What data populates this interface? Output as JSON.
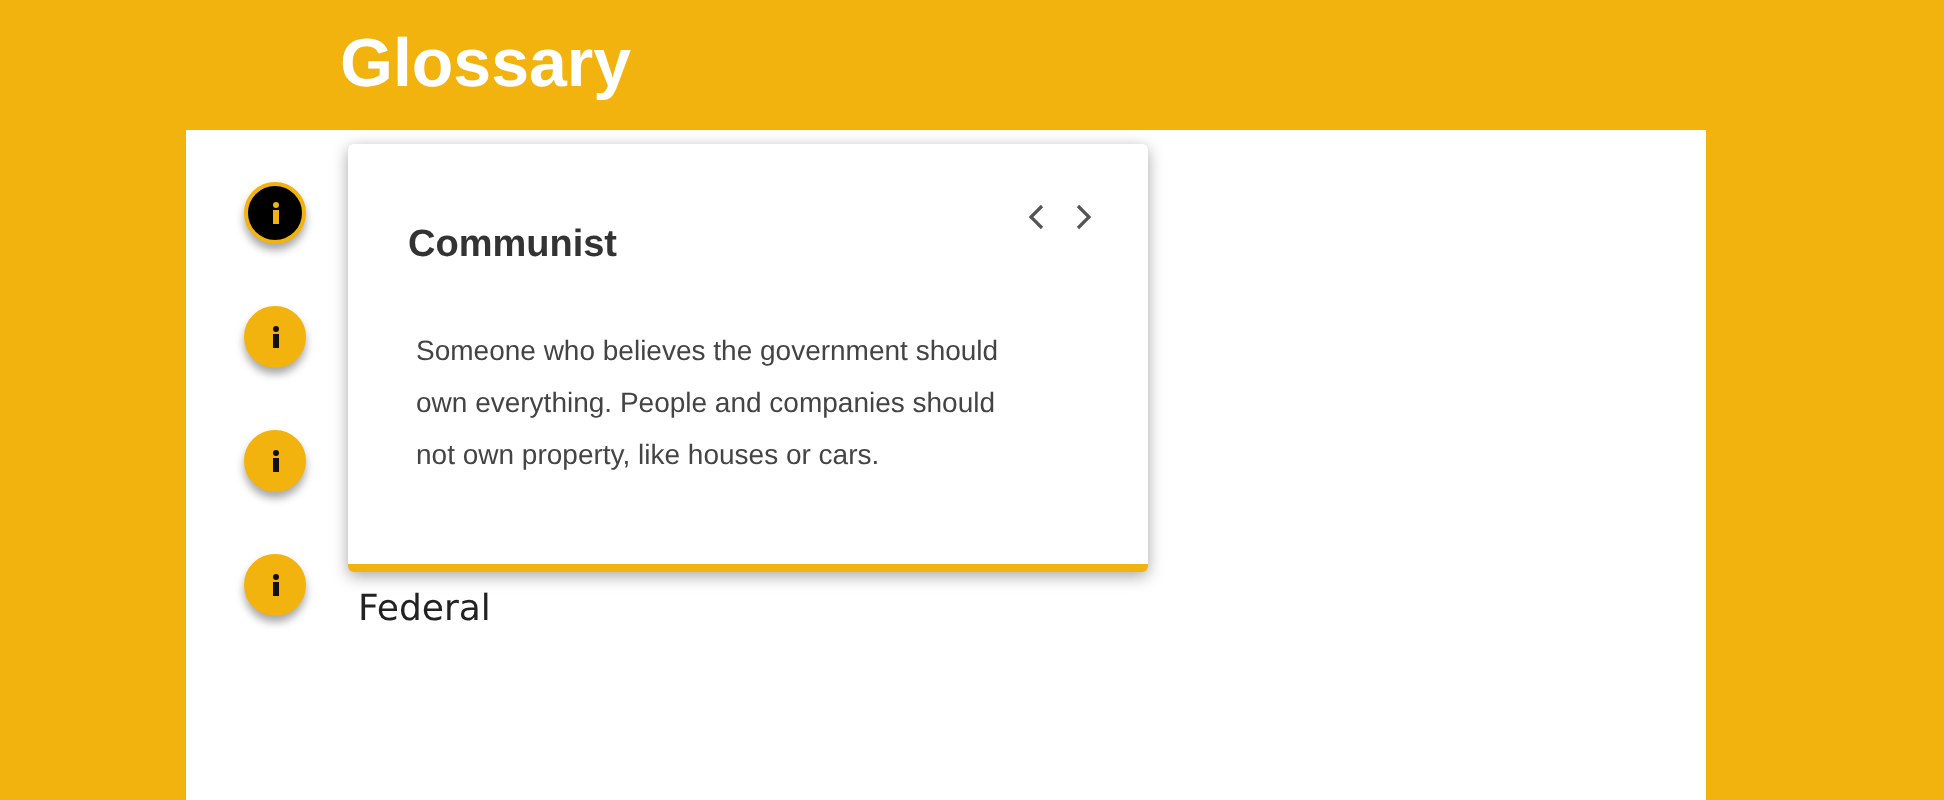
{
  "header": {
    "title": "Glossary"
  },
  "terms": [
    {
      "selected": true
    },
    {
      "selected": false
    },
    {
      "selected": false
    },
    {
      "selected": false,
      "label": "Federal"
    }
  ],
  "popover": {
    "term": "Communist",
    "definition": "Someone who believes the government should own everything. People and companies should not own property, like houses or cars."
  }
}
